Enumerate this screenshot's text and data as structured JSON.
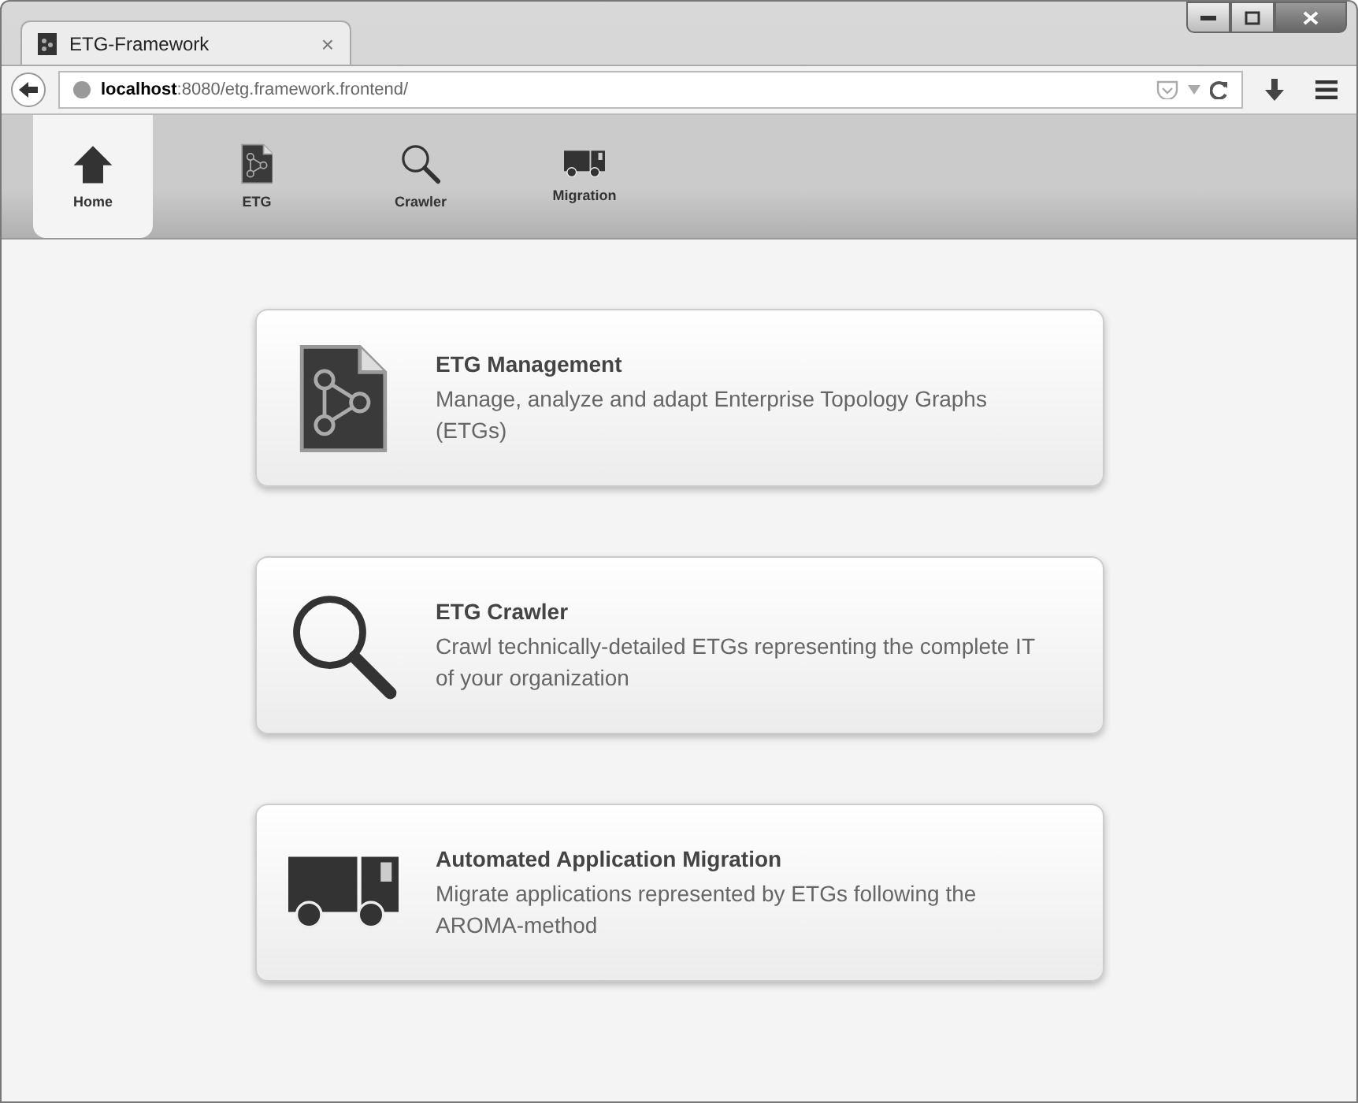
{
  "browser": {
    "tab_title": "ETG-Framework",
    "tab_close": "×",
    "url": "**localhost**:8080/etg.framework.frontend/"
  },
  "nav": [
    {
      "label": "Home",
      "kind": "home",
      "selected": true
    },
    {
      "label": "ETG",
      "kind": "graph",
      "selected": false
    },
    {
      "label": "Crawler",
      "kind": "search",
      "selected": false
    },
    {
      "label": "Migration",
      "kind": "truck",
      "selected": false
    }
  ],
  "cards": [
    {
      "kind": "graph",
      "title": "ETG Management",
      "description": "Manage, analyze and adapt Enterprise Topology Graphs (ETGs)"
    },
    {
      "kind": "search",
      "title": "ETG Crawler",
      "description": "Crawl technically-detailed ETGs representing the complete IT of your organization"
    },
    {
      "kind": "truck",
      "title": "Automated Application Migration",
      "description": "Migrate applications represented by ETGs following the AROMA-method"
    }
  ]
}
